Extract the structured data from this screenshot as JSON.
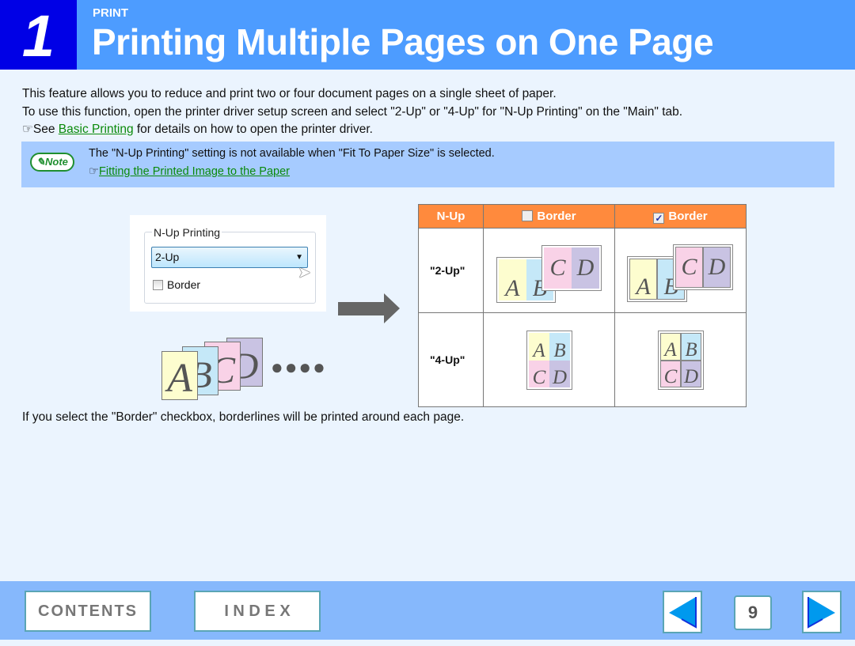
{
  "header": {
    "chapter_number": "1",
    "section": "PRINT",
    "title": "Printing Multiple Pages on One Page"
  },
  "intro": {
    "line1": "This feature allows you to reduce and print two or four document pages on a single sheet of paper.",
    "line2": "To use this function, open the printer driver setup screen and select \"2-Up\" or \"4-Up\" for \"N-Up Printing\" on the \"Main\" tab.",
    "see_prefix": "See ",
    "see_link": "Basic Printing",
    "see_suffix": " for details on how to open the printer driver."
  },
  "note": {
    "badge": "Note",
    "text": "The \"N-Up Printing\" setting is not available when \"Fit To Paper Size\" is selected.",
    "link": "Fitting the Printed Image to the Paper"
  },
  "dialog": {
    "group_label": "N-Up Printing",
    "select_value": "2-Up",
    "checkbox_label": "Border",
    "checkbox_checked": false
  },
  "table": {
    "headers": [
      "N-Up",
      "Border",
      "Border"
    ],
    "header_checkbox_states": [
      false,
      true
    ],
    "rows": [
      "\"2-Up\"",
      "\"4-Up\""
    ]
  },
  "pages": [
    "A",
    "B",
    "C",
    "D"
  ],
  "colors": {
    "header": "#4d9cff",
    "chapter": "#0000e6",
    "table_header": "#ff8a3d",
    "link": "#0a8a0a",
    "footer": "#86b8fc"
  },
  "footer": {
    "contents": "CONTENTS",
    "index": "I N D E X",
    "page": "9"
  },
  "closing": "If you select the \"Border\" checkbox, borderlines will be printed around each page."
}
